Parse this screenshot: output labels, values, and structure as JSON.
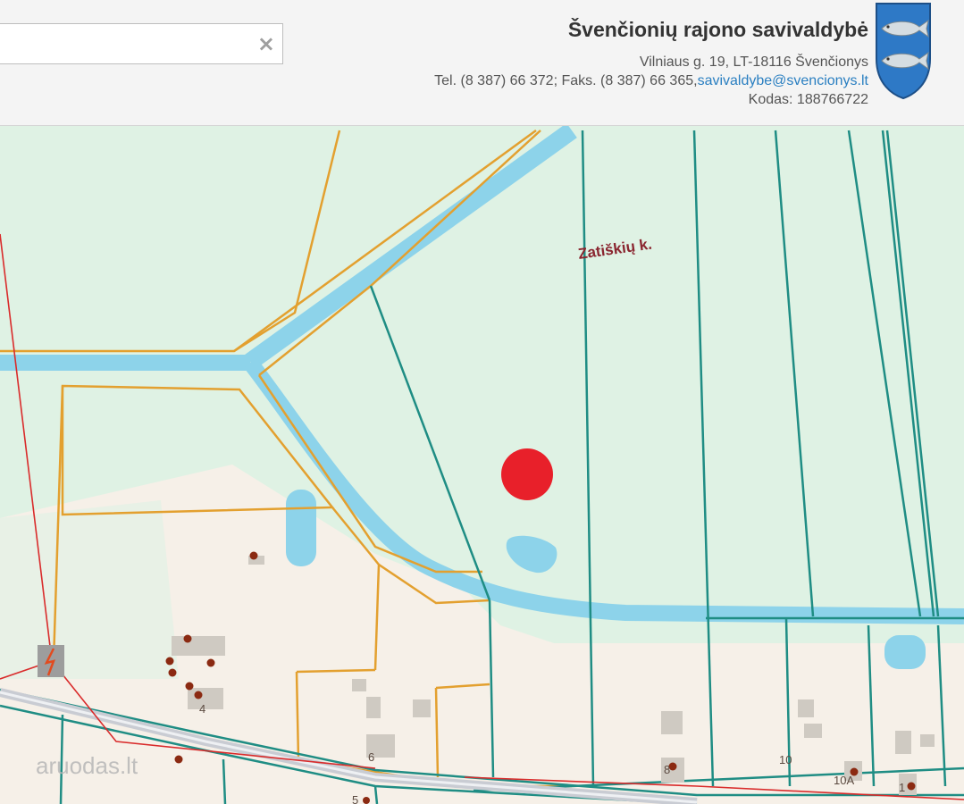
{
  "header": {
    "search": {
      "value": "",
      "placeholder": "",
      "clear_icon": "×"
    },
    "municipality": {
      "title": "Švenčionių rajono savivaldybė",
      "address": "Vilniaus g. 19, LT-18116 Švenčionys",
      "phone_fax": "Tel. (8 387) 66 372; Faks. (8 387) 66 365,",
      "email": "savivaldybe@svencionys.lt",
      "code": "Kodas: 188766722"
    },
    "coat_of_arms_icon": "coat-of-arms-two-fish"
  },
  "map": {
    "village_label": "Zatiškių k.",
    "house_numbers": [
      "4",
      "6",
      "8",
      "10",
      "10A",
      "1",
      "5"
    ],
    "watermark": "aruodas.lt",
    "marker_color": "#e8202a",
    "colors": {
      "background": "#dff2e4",
      "built_area": "#f6f0e8",
      "water": "#8dd3ea",
      "parcel_teal": "#1f8d84",
      "parcel_orange": "#e3a02f",
      "power_line": "#d92b2b",
      "road": "#c9ccd3"
    }
  }
}
